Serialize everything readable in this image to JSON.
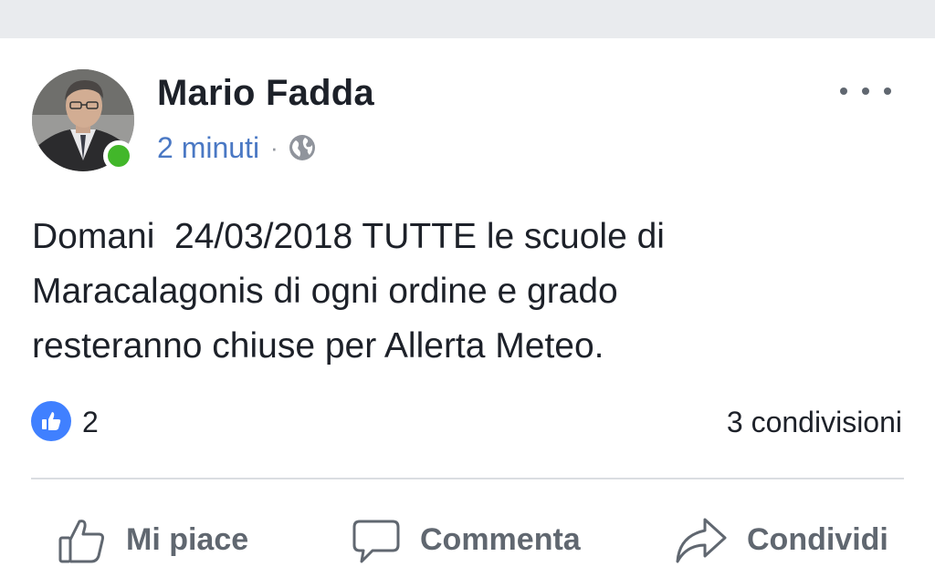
{
  "post": {
    "author_name": "Mario Fadda",
    "timestamp": "2 minuti",
    "separator": "·",
    "privacy_icon": "globe-icon",
    "more_icon": "more-options-icon",
    "text": "Domani  24/03/2018 TUTTE le scuole di\nMaracalagonis di ogni ordine e grado\nresteranno chiuse per Allerta Meteo.",
    "online": true
  },
  "reactions": {
    "icon": "like-icon",
    "count": "2",
    "shares": "3 condivisioni"
  },
  "actions": {
    "like_label": "Mi piace",
    "comment_label": "Commenta",
    "share_label": "Condividi"
  },
  "colors": {
    "link_blue": "#4a78c4",
    "like_blue": "#4080ff",
    "online_green": "#42b72a",
    "text": "#1d2129",
    "secondary_text": "#606770"
  }
}
